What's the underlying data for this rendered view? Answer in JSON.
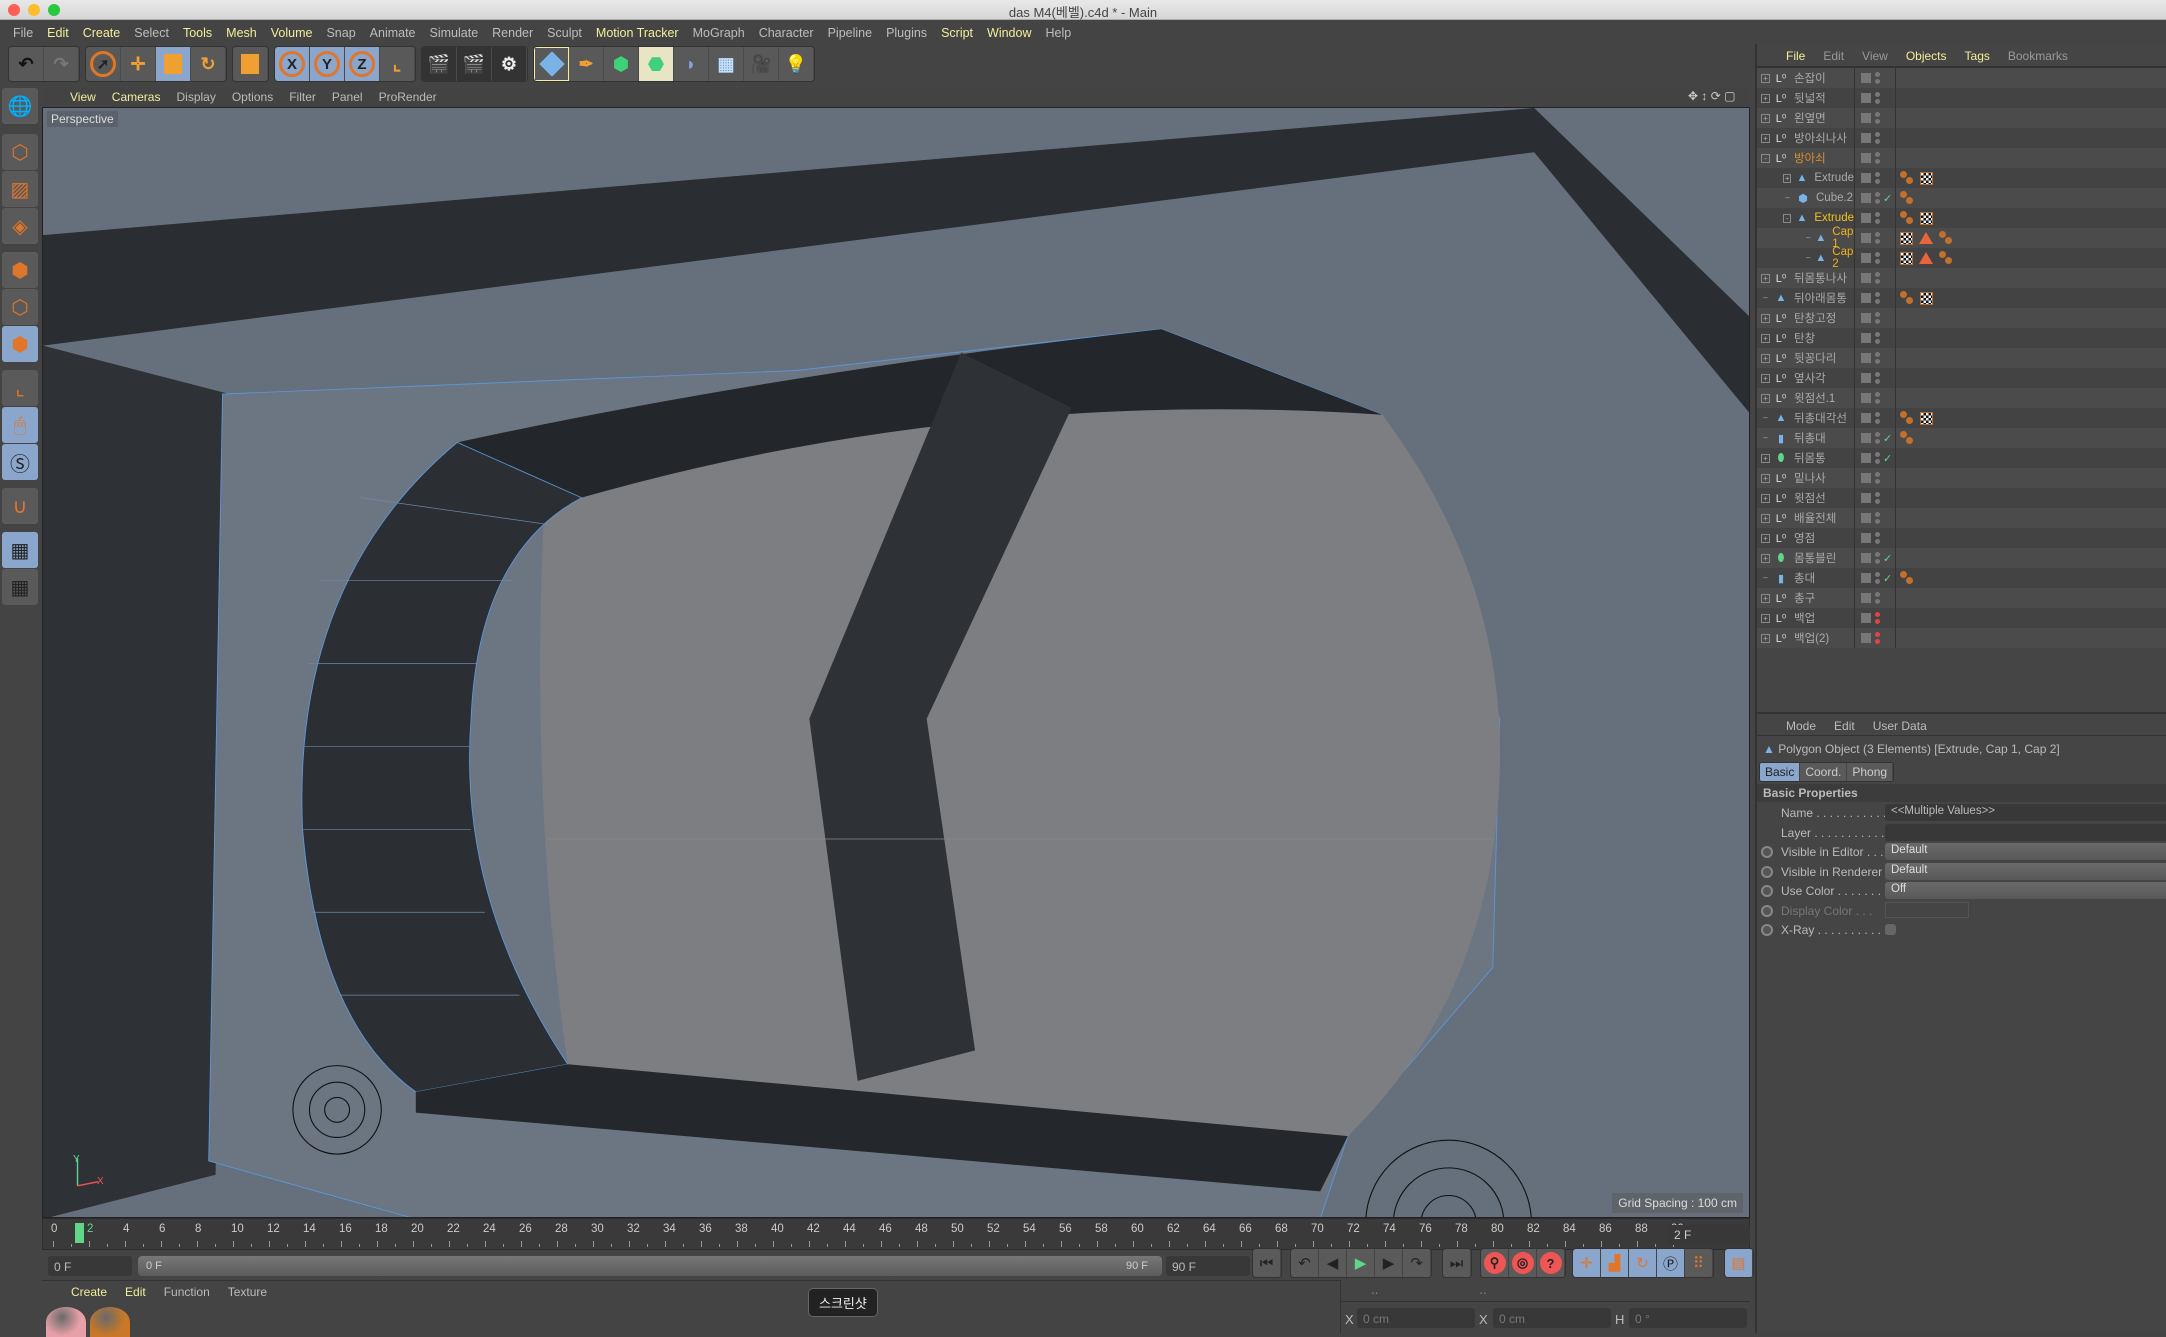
{
  "window": {
    "title": "das M4(베벨).c4d * - Main"
  },
  "menubar": [
    {
      "label": "File",
      "hl": false
    },
    {
      "label": "Edit",
      "hl": true
    },
    {
      "label": "Create",
      "hl": true
    },
    {
      "label": "Select",
      "hl": false
    },
    {
      "label": "Tools",
      "hl": true
    },
    {
      "label": "Mesh",
      "hl": true
    },
    {
      "label": "Volume",
      "hl": true
    },
    {
      "label": "Snap",
      "hl": false
    },
    {
      "label": "Animate",
      "hl": false
    },
    {
      "label": "Simulate",
      "hl": false
    },
    {
      "label": "Render",
      "hl": false
    },
    {
      "label": "Sculpt",
      "hl": false
    },
    {
      "label": "Motion Tracker",
      "hl": true
    },
    {
      "label": "MoGraph",
      "hl": false
    },
    {
      "label": "Character",
      "hl": false
    },
    {
      "label": "Pipeline",
      "hl": false
    },
    {
      "label": "Plugins",
      "hl": false
    },
    {
      "label": "Script",
      "hl": true
    },
    {
      "label": "Window",
      "hl": true
    },
    {
      "label": "Help",
      "hl": false
    }
  ],
  "toolbar": {
    "axis_x": "X",
    "axis_y": "Y",
    "axis_z": "Z"
  },
  "viewport": {
    "menu": [
      {
        "label": "View",
        "hl": true
      },
      {
        "label": "Cameras",
        "hl": true
      },
      {
        "label": "Display",
        "hl": false
      },
      {
        "label": "Options",
        "hl": false
      },
      {
        "label": "Filter",
        "hl": false
      },
      {
        "label": "Panel",
        "hl": false
      },
      {
        "label": "ProRender",
        "hl": false
      }
    ],
    "camera_label": "Perspective",
    "grid_spacing": "Grid Spacing : 100 cm",
    "axis_y": "Y",
    "axis_x": "X"
  },
  "timeline": {
    "start": 0,
    "end": 90,
    "step": 2,
    "current_frame": 2,
    "current_frame_field": "2 F"
  },
  "range": {
    "start_field": "0 F",
    "slider_start": "0 F",
    "slider_end": "90 F",
    "end_field": "90 F"
  },
  "materials": {
    "menu": [
      "Create",
      "Edit",
      "Function",
      "Texture"
    ],
    "colors": [
      "#e8a0a8",
      "#c87828"
    ]
  },
  "tooltip": "스크린샷",
  "coords": {
    "x_label": "X",
    "x_value": "0 cm",
    "x2_label": "X",
    "x2_value": "0 cm",
    "h_label": "H",
    "h_value": "0 °"
  },
  "object_manager": {
    "menu": [
      {
        "label": "File",
        "hl": true
      },
      {
        "label": "Edit",
        "hl": false
      },
      {
        "label": "View",
        "hl": false
      },
      {
        "label": "Objects",
        "hl": true
      },
      {
        "label": "Tags",
        "hl": true
      },
      {
        "label": "Bookmarks",
        "hl": false
      }
    ],
    "objects": [
      {
        "name": "손잡이",
        "type": "null",
        "indent": 0,
        "expander": "+",
        "tags": []
      },
      {
        "name": "뒷넓적",
        "type": "null",
        "indent": 0,
        "expander": "+",
        "tags": []
      },
      {
        "name": "왼옆면",
        "type": "null",
        "indent": 0,
        "expander": "+",
        "tags": []
      },
      {
        "name": "방아쇠나사",
        "type": "null",
        "indent": 0,
        "expander": "+",
        "tags": []
      },
      {
        "name": "방아쇠",
        "type": "null",
        "indent": 0,
        "expander": "-",
        "color": "#d8902e",
        "tags": []
      },
      {
        "name": "Extrude",
        "type": "polygon",
        "indent": 1,
        "expander": "+",
        "tags": [
          "material",
          "checker"
        ]
      },
      {
        "name": "Cube.2",
        "type": "cube",
        "indent": 1,
        "expander": "",
        "check": true,
        "tags": [
          "material"
        ]
      },
      {
        "name": "Extrude",
        "type": "polygon",
        "indent": 1,
        "expander": "-",
        "color": "#f0c020",
        "tags": [
          "material",
          "checker"
        ]
      },
      {
        "name": "Cap 1",
        "type": "polygon",
        "indent": 2,
        "expander": "",
        "color": "#f0b020",
        "tags": [
          "checker",
          "triangle",
          "material"
        ]
      },
      {
        "name": "Cap 2",
        "type": "polygon",
        "indent": 2,
        "expander": "",
        "color": "#f0b020",
        "tags": [
          "checker",
          "triangle",
          "material"
        ]
      },
      {
        "name": "뒤몸통나사",
        "type": "null",
        "indent": 0,
        "expander": "+",
        "tags": []
      },
      {
        "name": "뒤아래몸통",
        "type": "polygon",
        "indent": 0,
        "expander": "",
        "tags": [
          "material",
          "checker"
        ]
      },
      {
        "name": "탄창고정",
        "type": "null",
        "indent": 0,
        "expander": "+",
        "tags": []
      },
      {
        "name": "탄창",
        "type": "null",
        "indent": 0,
        "expander": "+",
        "tags": []
      },
      {
        "name": "뒷꽁다리",
        "type": "null",
        "indent": 0,
        "expander": "+",
        "tags": []
      },
      {
        "name": "옆사각",
        "type": "null",
        "indent": 0,
        "expander": "+",
        "tags": []
      },
      {
        "name": "윗점선.1",
        "type": "null",
        "indent": 0,
        "expander": "+",
        "tags": []
      },
      {
        "name": "뒤총대각선",
        "type": "polygon",
        "indent": 0,
        "expander": "",
        "tags": [
          "material",
          "checker"
        ]
      },
      {
        "name": "뒤총대",
        "type": "cylinder",
        "indent": 0,
        "expander": "",
        "check": true,
        "tags": [
          "material"
        ]
      },
      {
        "name": "뒤몸통",
        "type": "boole",
        "indent": 0,
        "expander": "+",
        "check": true,
        "tags": []
      },
      {
        "name": "밑나사",
        "type": "null",
        "indent": 0,
        "expander": "+",
        "tags": []
      },
      {
        "name": "윗점선",
        "type": "null",
        "indent": 0,
        "expander": "+",
        "tags": []
      },
      {
        "name": "배율전체",
        "type": "null",
        "indent": 0,
        "expander": "+",
        "tags": []
      },
      {
        "name": "영점",
        "type": "null",
        "indent": 0,
        "expander": "+",
        "tags": []
      },
      {
        "name": "몸통블린",
        "type": "boole",
        "indent": 0,
        "expander": "+",
        "check": true,
        "tags": []
      },
      {
        "name": "총대",
        "type": "cylinder",
        "indent": 0,
        "expander": "",
        "check": true,
        "tags": [
          "material"
        ]
      },
      {
        "name": "총구",
        "type": "null",
        "indent": 0,
        "expander": "+",
        "tags": []
      },
      {
        "name": "백업",
        "type": "null",
        "indent": 0,
        "expander": "+",
        "red": true,
        "tags": []
      },
      {
        "name": "백업(2)",
        "type": "null",
        "indent": 0,
        "expander": "+",
        "red": true,
        "tags": []
      }
    ]
  },
  "attributes": {
    "menu": [
      "Mode",
      "Edit",
      "User Data"
    ],
    "title": "Polygon Object (3 Elements) [Extrude, Cap 1, Cap 2]",
    "tabs": [
      {
        "label": "Basic",
        "active": true
      },
      {
        "label": "Coord.",
        "active": false
      },
      {
        "label": "Phong",
        "active": false
      }
    ],
    "section": "Basic Properties",
    "props": [
      {
        "label": "Name . . . . . . . . . . .",
        "value": "<<Multiple Values>>",
        "kind": "txt",
        "radio": false
      },
      {
        "label": "Layer . . . . . . . . . . .",
        "value": "",
        "kind": "txt",
        "radio": false
      },
      {
        "label": "Visible in Editor . . .",
        "value": "Default",
        "kind": "drop",
        "radio": true
      },
      {
        "label": "Visible in Renderer",
        "value": "Default",
        "kind": "drop",
        "radio": true
      },
      {
        "label": "Use Color . . . . . . . .",
        "value": "Off",
        "kind": "drop",
        "radio": true
      },
      {
        "label": "Display Color . . .",
        "value": "",
        "kind": "color",
        "radio": true
      },
      {
        "label": "X-Ray . . . . . . . . . . .",
        "value": "",
        "kind": "check",
        "radio": true
      }
    ]
  }
}
